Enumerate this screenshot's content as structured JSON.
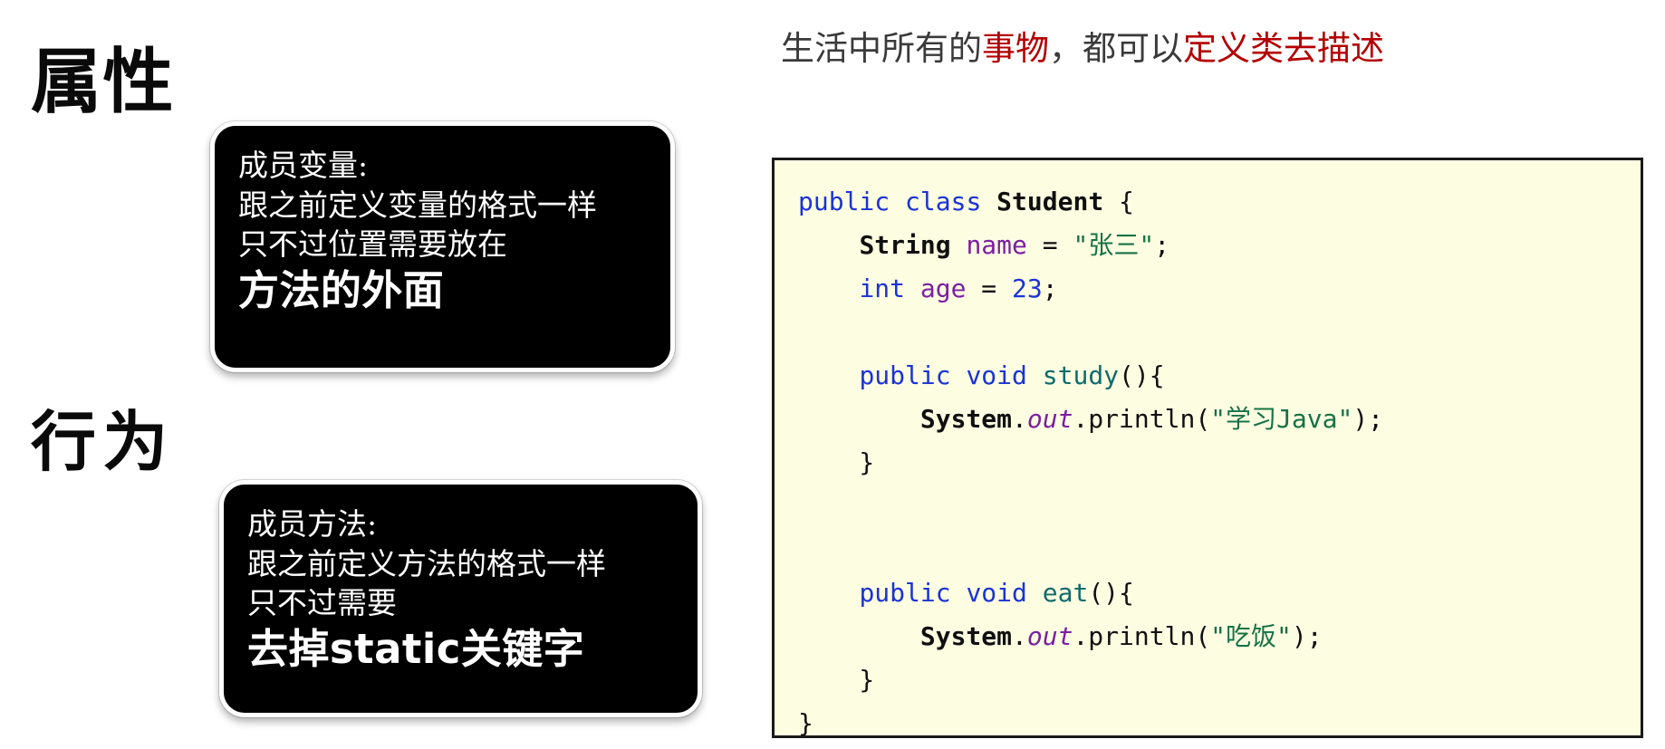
{
  "left_labels": {
    "attribute": "属性",
    "behavior": "行为"
  },
  "callouts": [
    {
      "id": "attribute",
      "title": "成员变量:",
      "line2": "跟之前定义变量的格式一样",
      "line3": "只不过位置需要放在",
      "emphasis": "方法的外面"
    },
    {
      "id": "behavior",
      "title": "成员方法:",
      "line2": "跟之前定义方法的格式一样",
      "line3": "只不过需要",
      "emphasis": "去掉static关键字"
    }
  ],
  "heading": {
    "part1": "生活中所有的",
    "highlight1": "事物",
    "part2": "，都可以",
    "highlight2": "定义类去描述"
  },
  "code": {
    "language": "java",
    "lines": [
      {
        "tokens": [
          {
            "t": "public",
            "c": "kw"
          },
          {
            "t": " ",
            "c": "plain"
          },
          {
            "t": "class",
            "c": "kw"
          },
          {
            "t": " ",
            "c": "plain"
          },
          {
            "t": "Student",
            "c": "type"
          },
          {
            "t": " {",
            "c": "plain"
          }
        ]
      },
      {
        "tokens": [
          {
            "t": "    ",
            "c": "plain"
          },
          {
            "t": "String",
            "c": "type"
          },
          {
            "t": " ",
            "c": "plain"
          },
          {
            "t": "name",
            "c": "var"
          },
          {
            "t": " = ",
            "c": "plain"
          },
          {
            "t": "\"张三\"",
            "c": "str"
          },
          {
            "t": ";",
            "c": "plain"
          }
        ]
      },
      {
        "tokens": [
          {
            "t": "    ",
            "c": "plain"
          },
          {
            "t": "int",
            "c": "kw"
          },
          {
            "t": " ",
            "c": "plain"
          },
          {
            "t": "age",
            "c": "var"
          },
          {
            "t": " = ",
            "c": "plain"
          },
          {
            "t": "23",
            "c": "num"
          },
          {
            "t": ";",
            "c": "plain"
          }
        ]
      },
      {
        "tokens": [
          {
            "t": "",
            "c": "plain"
          }
        ]
      },
      {
        "tokens": [
          {
            "t": "    ",
            "c": "plain"
          },
          {
            "t": "public",
            "c": "kw"
          },
          {
            "t": " ",
            "c": "plain"
          },
          {
            "t": "void",
            "c": "kw"
          },
          {
            "t": " ",
            "c": "plain"
          },
          {
            "t": "study",
            "c": "fn"
          },
          {
            "t": "(){",
            "c": "plain"
          }
        ]
      },
      {
        "tokens": [
          {
            "t": "        ",
            "c": "plain"
          },
          {
            "t": "System",
            "c": "type"
          },
          {
            "t": ".",
            "c": "plain"
          },
          {
            "t": "out",
            "c": "field"
          },
          {
            "t": ".println(",
            "c": "plain"
          },
          {
            "t": "\"学习Java\"",
            "c": "str"
          },
          {
            "t": ");",
            "c": "plain"
          }
        ]
      },
      {
        "tokens": [
          {
            "t": "    }",
            "c": "plain"
          }
        ]
      },
      {
        "tokens": [
          {
            "t": "",
            "c": "plain"
          }
        ]
      },
      {
        "tokens": [
          {
            "t": "",
            "c": "plain"
          }
        ]
      },
      {
        "tokens": [
          {
            "t": "    ",
            "c": "plain"
          },
          {
            "t": "public",
            "c": "kw"
          },
          {
            "t": " ",
            "c": "plain"
          },
          {
            "t": "void",
            "c": "kw"
          },
          {
            "t": " ",
            "c": "plain"
          },
          {
            "t": "eat",
            "c": "fn"
          },
          {
            "t": "(){",
            "c": "plain"
          }
        ]
      },
      {
        "tokens": [
          {
            "t": "        ",
            "c": "plain"
          },
          {
            "t": "System",
            "c": "type"
          },
          {
            "t": ".",
            "c": "plain"
          },
          {
            "t": "out",
            "c": "field"
          },
          {
            "t": ".println(",
            "c": "plain"
          },
          {
            "t": "\"吃饭\"",
            "c": "str"
          },
          {
            "t": ");",
            "c": "plain"
          }
        ]
      },
      {
        "tokens": [
          {
            "t": "    }",
            "c": "plain"
          }
        ]
      },
      {
        "tokens": [
          {
            "t": "}",
            "c": "plain"
          }
        ]
      }
    ]
  },
  "colors": {
    "keyword": "#1a33d6",
    "string": "#177245",
    "variable": "#7b1fa2",
    "method": "#0f6b6b",
    "number": "#1a33d6",
    "code_background": "#fdfde2",
    "code_border": "#1a1a1a",
    "callout_background": "#000000",
    "heading_highlight": "#b40000",
    "heading_text": "#3a3a3a"
  }
}
